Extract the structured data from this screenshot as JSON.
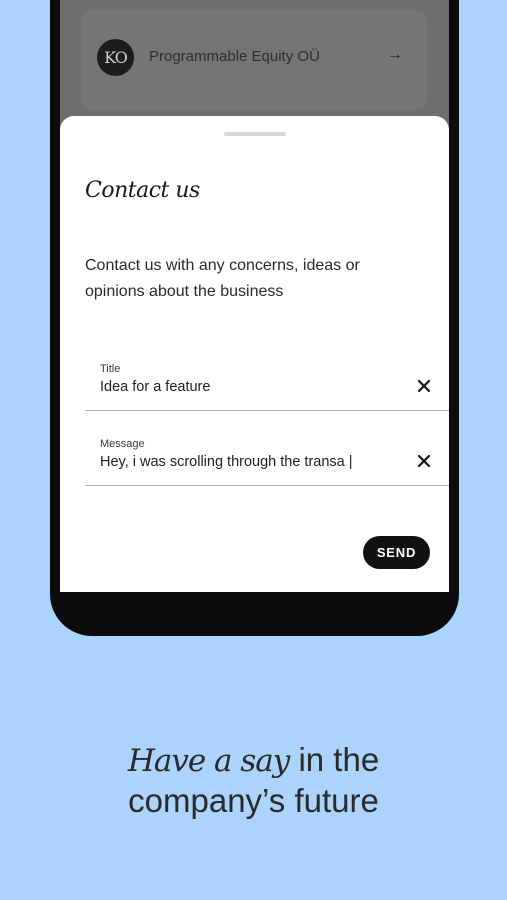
{
  "background_color": "#acd3fb",
  "company_card": {
    "logo_text": "KO",
    "name": "Programmable Equity OÜ",
    "arrow": "→"
  },
  "contact_sheet": {
    "title": "Contact us",
    "description": "Contact us with any concerns, ideas or opinions about the business",
    "fields": [
      {
        "label": "Title",
        "value": "Idea for a feature"
      },
      {
        "label": "Message",
        "value": "Hey, i was scrolling through the transa |"
      }
    ],
    "send_label": "SEND"
  },
  "tagline": {
    "emphasis": "Have a say",
    "rest_line1": " in the",
    "line2": "company’s future"
  }
}
